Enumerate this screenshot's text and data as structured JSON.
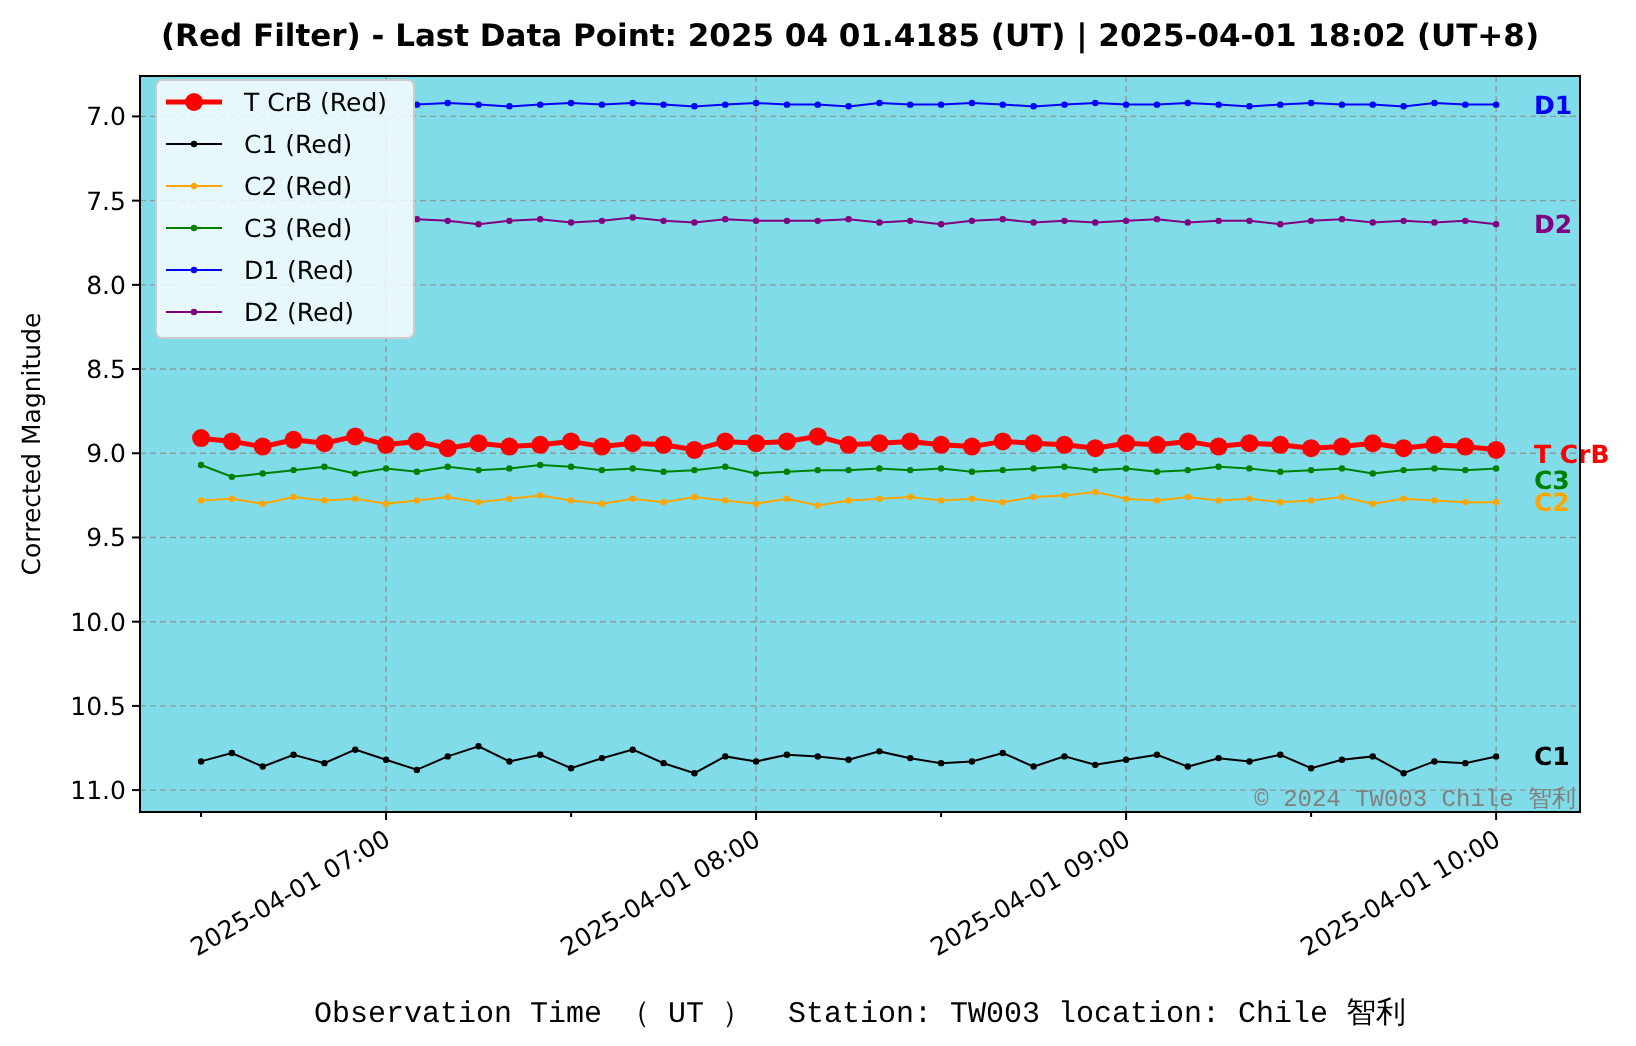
{
  "chart_data": {
    "type": "line",
    "title": "(Red Filter) - Last Data Point: 2025 04 01.4185 (UT) | 2025-04-01 18:02 (UT+8)",
    "xlabel": "Observation Time （ UT ）  Station: TW003 location: Chile 智利",
    "ylabel": "Corrected Magnitude",
    "categories": [
      null,
      null,
      null,
      null,
      null,
      null,
      "2025-04-01 07:00",
      null,
      null,
      null,
      null,
      null,
      null,
      null,
      null,
      null,
      null,
      null,
      "2025-04-01 08:00",
      null,
      null,
      null,
      null,
      null,
      null,
      null,
      null,
      null,
      null,
      null,
      "2025-04-01 09:00",
      null,
      null,
      null,
      null,
      null,
      null,
      null,
      null,
      null,
      null,
      null,
      "2025-04-01 10:00"
    ],
    "series": [
      {
        "name": "T CrB (Red)",
        "color": "#ff0000",
        "marker": "o",
        "values": [
          8.91,
          8.93,
          8.96,
          8.92,
          8.94,
          8.9,
          8.95,
          8.93,
          8.97,
          8.94,
          8.96,
          8.95,
          8.93,
          8.96,
          8.94,
          8.95,
          8.98,
          8.93,
          8.94,
          8.93,
          8.9,
          8.95,
          8.94,
          8.93,
          8.95,
          8.96,
          8.93,
          8.94,
          8.95,
          8.97,
          8.94,
          8.95,
          8.93,
          8.96,
          8.94,
          8.95,
          8.97,
          8.96,
          8.94,
          8.97,
          8.95,
          8.96,
          8.98
        ]
      },
      {
        "name": "C1 (Red)",
        "color": "#000000",
        "marker": "o",
        "values": [
          10.83,
          10.78,
          10.86,
          10.79,
          10.84,
          10.76,
          10.82,
          10.88,
          10.8,
          10.74,
          10.83,
          10.79,
          10.87,
          10.81,
          10.76,
          10.84,
          10.9,
          10.8,
          10.83,
          10.79,
          10.8,
          10.82,
          10.77,
          10.81,
          10.84,
          10.83,
          10.78,
          10.86,
          10.8,
          10.85,
          10.82,
          10.79,
          10.86,
          10.81,
          10.83,
          10.79,
          10.87,
          10.82,
          10.8,
          10.9,
          10.83,
          10.84,
          10.8
        ]
      },
      {
        "name": "C2 (Red)",
        "color": "#ffa500",
        "marker": "o",
        "values": [
          9.28,
          9.27,
          9.3,
          9.26,
          9.28,
          9.27,
          9.3,
          9.28,
          9.26,
          9.29,
          9.27,
          9.25,
          9.28,
          9.3,
          9.27,
          9.29,
          9.26,
          9.28,
          9.3,
          9.27,
          9.31,
          9.28,
          9.27,
          9.26,
          9.28,
          9.27,
          9.29,
          9.26,
          9.25,
          9.23,
          9.27,
          9.28,
          9.26,
          9.28,
          9.27,
          9.29,
          9.28,
          9.26,
          9.3,
          9.27,
          9.28,
          9.29,
          9.29
        ]
      },
      {
        "name": "C3 (Red)",
        "color": "#008000",
        "marker": "o",
        "values": [
          9.07,
          9.14,
          9.12,
          9.1,
          9.08,
          9.12,
          9.09,
          9.11,
          9.08,
          9.1,
          9.09,
          9.07,
          9.08,
          9.1,
          9.09,
          9.11,
          9.1,
          9.08,
          9.12,
          9.11,
          9.1,
          9.1,
          9.09,
          9.1,
          9.09,
          9.11,
          9.1,
          9.09,
          9.08,
          9.1,
          9.09,
          9.11,
          9.1,
          9.08,
          9.09,
          9.11,
          9.1,
          9.09,
          9.12,
          9.1,
          9.09,
          9.1,
          9.09
        ]
      },
      {
        "name": "D1 (Red)",
        "color": "#0000ff",
        "marker": "o",
        "values": [
          null,
          null,
          null,
          null,
          null,
          null,
          null,
          6.93,
          6.92,
          6.93,
          6.94,
          6.93,
          6.92,
          6.93,
          6.92,
          6.93,
          6.94,
          6.93,
          6.92,
          6.93,
          6.93,
          6.94,
          6.92,
          6.93,
          6.93,
          6.92,
          6.93,
          6.94,
          6.93,
          6.92,
          6.93,
          6.93,
          6.92,
          6.93,
          6.94,
          6.93,
          6.92,
          6.93,
          6.93,
          6.94,
          6.92,
          6.93,
          6.93
        ]
      },
      {
        "name": "D2 (Red)",
        "color": "#800080",
        "marker": "o",
        "values": [
          null,
          null,
          null,
          null,
          null,
          null,
          null,
          7.61,
          7.62,
          7.64,
          7.62,
          7.61,
          7.63,
          7.62,
          7.6,
          7.62,
          7.63,
          7.61,
          7.62,
          7.62,
          7.62,
          7.61,
          7.63,
          7.62,
          7.64,
          7.62,
          7.61,
          7.63,
          7.62,
          7.63,
          7.62,
          7.61,
          7.63,
          7.62,
          7.62,
          7.64,
          7.62,
          7.61,
          7.63,
          7.62,
          7.63,
          7.62,
          7.64
        ]
      }
    ],
    "grid": true,
    "legend": "upper left",
    "ylim": [
      11.13,
      6.76
    ],
    "yticks": [
      {
        "value": 7,
        "label": "7.0"
      },
      {
        "value": 7.5,
        "label": "7.5"
      },
      {
        "value": 8,
        "label": "8.0"
      },
      {
        "value": 8.5,
        "label": "8.5"
      },
      {
        "value": 9,
        "label": "9.0"
      },
      {
        "value": 9.5,
        "label": "9.5"
      },
      {
        "value": 10,
        "label": "10.0"
      },
      {
        "value": 10.5,
        "label": "10.5"
      },
      {
        "value": 11,
        "label": "11.0"
      }
    ],
    "annotations": [
      "T CrB",
      "C1",
      "C2",
      "C3",
      "D1",
      "D2",
      "© 2024 TW003 Chile 智利"
    ]
  }
}
